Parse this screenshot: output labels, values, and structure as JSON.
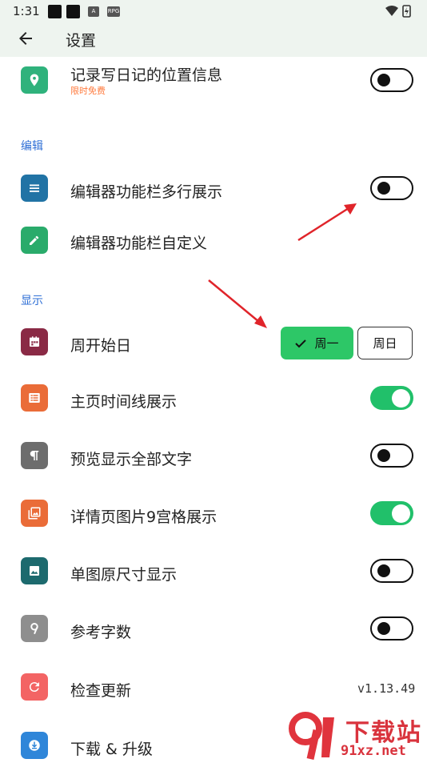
{
  "status": {
    "time": "1:31",
    "icon_a": "A",
    "icon_b": "RPG"
  },
  "header": {
    "title": "设置"
  },
  "rows": {
    "location": {
      "label": "记录写日记的位置信息",
      "sub": "限时免费",
      "toggle": false
    },
    "section_edit": "编辑",
    "toolbar_multiline": {
      "label": "编辑器功能栏多行展示",
      "toggle": false
    },
    "toolbar_custom": {
      "label": "编辑器功能栏自定义"
    },
    "section_display": "显示",
    "week_start": {
      "label": "周开始日",
      "option_selected": "周一",
      "option_other": "周日"
    },
    "timeline": {
      "label": "主页时间线展示",
      "toggle": true
    },
    "preview_text": {
      "label": "预览显示全部文字",
      "toggle": false
    },
    "grid9": {
      "label": "详情页图片9宫格展示",
      "toggle": true
    },
    "single_image": {
      "label": "单图原尺寸显示",
      "toggle": false
    },
    "word_count": {
      "label": "参考字数",
      "toggle": false
    },
    "check_update": {
      "label": "检查更新",
      "version": "v1.13.49"
    },
    "download": {
      "label": "下载 & 升级"
    }
  },
  "watermark": {
    "text": "下载站",
    "url": "91xz.net"
  },
  "colors": {
    "accent": "#21c06a",
    "section": "#2f6fd6",
    "free_tag": "#ff7a3d",
    "icon_location": "#2fb27c",
    "icon_toolbar": "#2173a5",
    "icon_custom": "#2aab6b",
    "icon_week": "#8a2a45",
    "icon_timeline": "#ea6c38",
    "icon_preview": "#6d6d6d",
    "icon_grid": "#ea6c38",
    "icon_single": "#1d6a6e",
    "icon_words": "#8e8e8e",
    "icon_update": "#f36464",
    "icon_download": "#2f86d9"
  }
}
